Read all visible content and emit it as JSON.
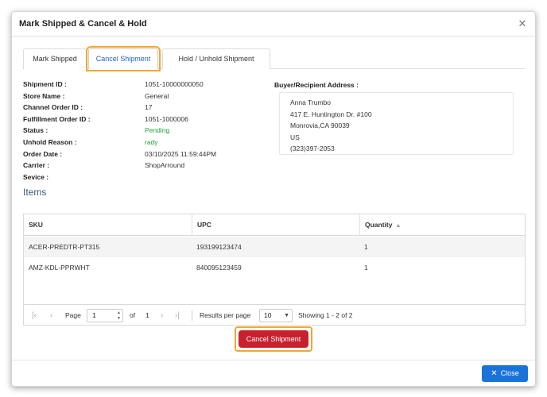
{
  "dialog": {
    "title": "Mark Shipped & Cancel & Hold"
  },
  "tabs": [
    {
      "label": "Mark Shipped"
    },
    {
      "label": "Cancel Shipment"
    },
    {
      "label": "Hold / Unhold Shipment"
    }
  ],
  "info": [
    {
      "label": "Shipment ID :",
      "value": "1051-10000000050"
    },
    {
      "label": "Store Name :",
      "value": "General"
    },
    {
      "label": "Channel Order ID :",
      "value": "17"
    },
    {
      "label": "Fulfillment Order ID :",
      "value": "1051-1000006"
    },
    {
      "label": "Status :",
      "value": "Pending"
    },
    {
      "label": "Unhold Reason :",
      "value": "rady"
    },
    {
      "label": "Order Date :",
      "value": "03/10/2025 11:59:44PM"
    },
    {
      "label": "Carrier :",
      "value": "ShopArround"
    },
    {
      "label": "Sevice :",
      "value": ""
    }
  ],
  "address": {
    "label": "Buyer/Recipient Address :",
    "lines": [
      "Anna Trumbo",
      "417 E. Huntington Dr. #100",
      "Monrovia,CA 90039",
      "US",
      "(323)397-2053"
    ]
  },
  "items": {
    "title": "Items",
    "columns": [
      "SKU",
      "UPC",
      "Quantity"
    ],
    "rows": [
      [
        "ACER-PREDTR-PT315",
        "193199123474",
        "1"
      ],
      [
        "AMZ-KDL-PPRWHT",
        "840095123459",
        "1"
      ]
    ]
  },
  "pager": {
    "page_label": "Page",
    "page_value": "1",
    "of_label": "of",
    "total_pages": "1",
    "rpp_label": "Results per page",
    "rpp_value": "10",
    "showing": "Showing 1 - 2 of 2"
  },
  "actions": {
    "cancel_label": "Cancel Shipment",
    "close_label": "Close"
  },
  "colors": {
    "primary": "#1a73d9",
    "danger": "#c9202e",
    "highlight": "#f0a830",
    "success": "#1e9e3a"
  }
}
